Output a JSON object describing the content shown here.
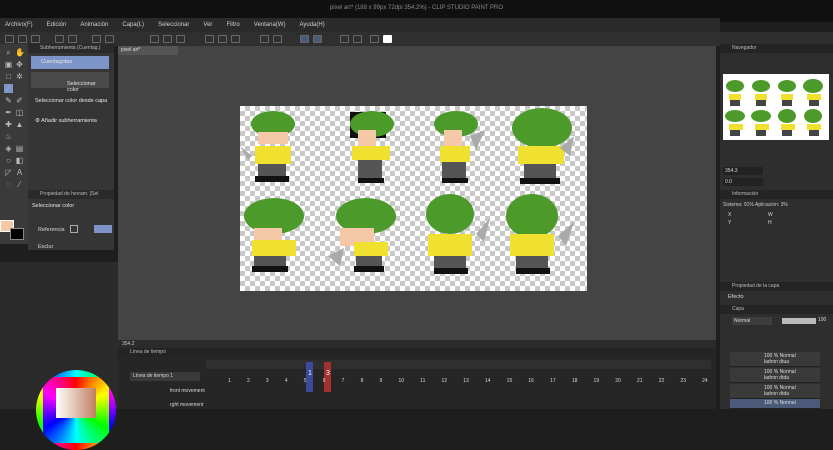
{
  "window": {
    "title": "pixel art* (188 x 99px 72dpi 354.2%)  - CLIP STUDIO PAINT PRO"
  },
  "menu": [
    "Archivo(F)",
    "Edición",
    "Animación",
    "Capa(L)",
    "Seleccionar",
    "Ver",
    "Filtro",
    "Ventana(W)",
    "Ayuda(H)"
  ],
  "subtool": {
    "header": "Subherramienta (Cuentag.)",
    "items": [
      "Cuentagotas",
      "Seleccionar color",
      "Seleccionar color desde capa"
    ],
    "add_label": "Añadir subherramienta"
  },
  "tool_property": {
    "header": "Propiedad de herram. [Sel",
    "name": "Seleccionar color",
    "reference_label": "Referencia",
    "exclude_label": "Exclur"
  },
  "document": {
    "tab": "pixel art*",
    "zoom": "354.2"
  },
  "timeline": {
    "header": "Línea de tiempo",
    "select_label": "Línea de tiempo 1",
    "frame_labels": [
      "1",
      "2",
      "3",
      "4",
      "5",
      "6",
      "7",
      "8",
      "9",
      "10",
      "11",
      "12",
      "13",
      "14",
      "15",
      "16",
      "17",
      "18",
      "19",
      "20",
      "21",
      "22",
      "23",
      "24"
    ],
    "big_numbers": [
      "1",
      "3"
    ],
    "tracks": [
      "front movement",
      "rght movement"
    ]
  },
  "navigator": {
    "header": "Navegador",
    "zoom_value": "354.3",
    "rotate_value": "0.0"
  },
  "info": {
    "header": "Información",
    "system_label": "Sistema:",
    "system_value": "91%",
    "app_label": "Aplicación:",
    "app_value": "3%",
    "x_label": "X",
    "y_label": "Y",
    "w_label": "W",
    "h_label": "H"
  },
  "layer_property": {
    "header": "Propiedad de la capa",
    "effect_label": "Efecto"
  },
  "layer_panel": {
    "header": "Capa",
    "blend_mode": "Normal",
    "opacity": "100",
    "layers": [
      {
        "pct": "100 % Normal",
        "name": "ladron dtua"
      },
      {
        "pct": "100 % Normal",
        "name": "ladron dtda"
      },
      {
        "pct": "100 % Normal",
        "name": "ladron dtda"
      },
      {
        "pct": "100 % Normal",
        "name": "ladron dtua"
      }
    ]
  },
  "colors": {
    "accent": "#7d94c8",
    "hat": "#4c9a2a",
    "shirt": "#f0e030",
    "skin": "#f5c9a8",
    "brand": "#2a2a2a"
  }
}
